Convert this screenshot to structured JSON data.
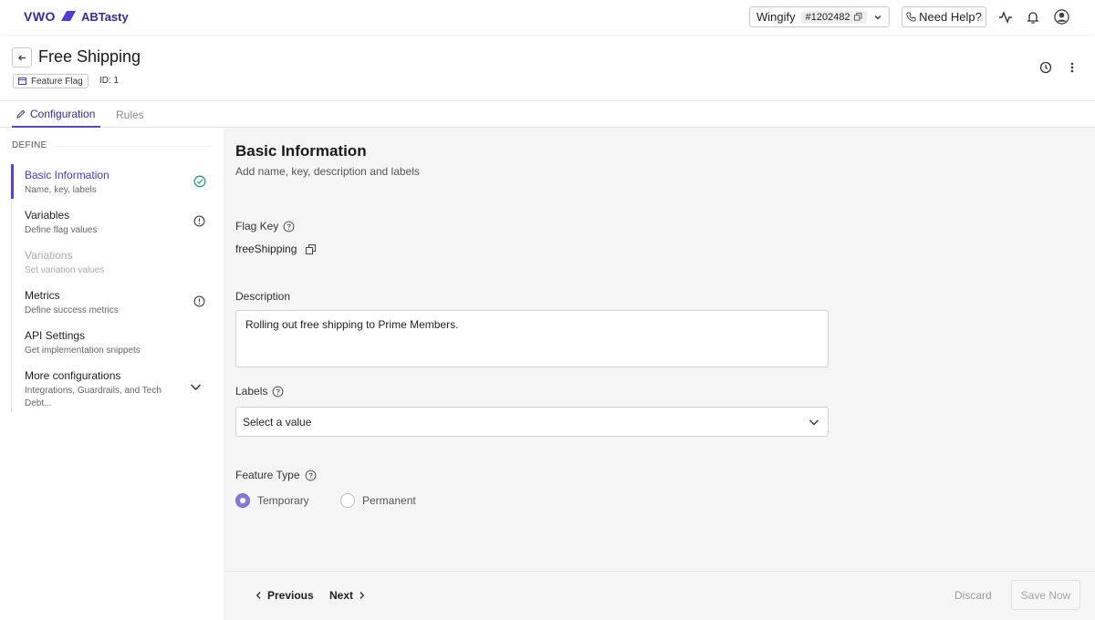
{
  "brand": {
    "vwo": "VWO",
    "abtasty": "ABTasty",
    "accent": "#5a47b8"
  },
  "topbar": {
    "account_name": "Wingify",
    "account_id": "#1202482",
    "help_label": "Need Help?",
    "icons": [
      "activity-icon",
      "bell-icon",
      "user-avatar-icon"
    ]
  },
  "header": {
    "title": "Free Shipping",
    "badge": "Feature Flag",
    "id_text": "ID: 1"
  },
  "tabs": [
    {
      "label": "Configuration",
      "active": true
    },
    {
      "label": "Rules",
      "active": false
    }
  ],
  "sidebar": {
    "section": "DEFINE",
    "items": [
      {
        "title": "Basic Information",
        "sub": "Name, key, labels",
        "status": "complete"
      },
      {
        "title": "Variables",
        "sub": "Define flag values",
        "status": "warning"
      },
      {
        "title": "Variations",
        "sub": "Set variation values",
        "status": "disabled"
      },
      {
        "title": "Metrics",
        "sub": "Define success metrics",
        "status": "warning"
      },
      {
        "title": "API Settings",
        "sub": "Get implementation snippets",
        "status": "none"
      },
      {
        "title": "More configurations",
        "sub": "Integrations, Guardrails, and Tech Debt...",
        "status": "expand"
      }
    ]
  },
  "main": {
    "title": "Basic Information",
    "subtitle": "Add name, key, description and labels",
    "flag_key_label": "Flag Key",
    "flag_key_value": "freeShipping",
    "description_label": "Description",
    "description_value": "Rolling out free shipping to Prime Members.",
    "labels_label": "Labels",
    "labels_placeholder": "Select a value",
    "feature_type_label": "Feature Type",
    "feature_type_options": [
      "Temporary",
      "Permanent"
    ],
    "feature_type_selected": "Temporary"
  },
  "footer": {
    "previous": "Previous",
    "next": "Next",
    "discard": "Discard",
    "save": "Save Now"
  }
}
